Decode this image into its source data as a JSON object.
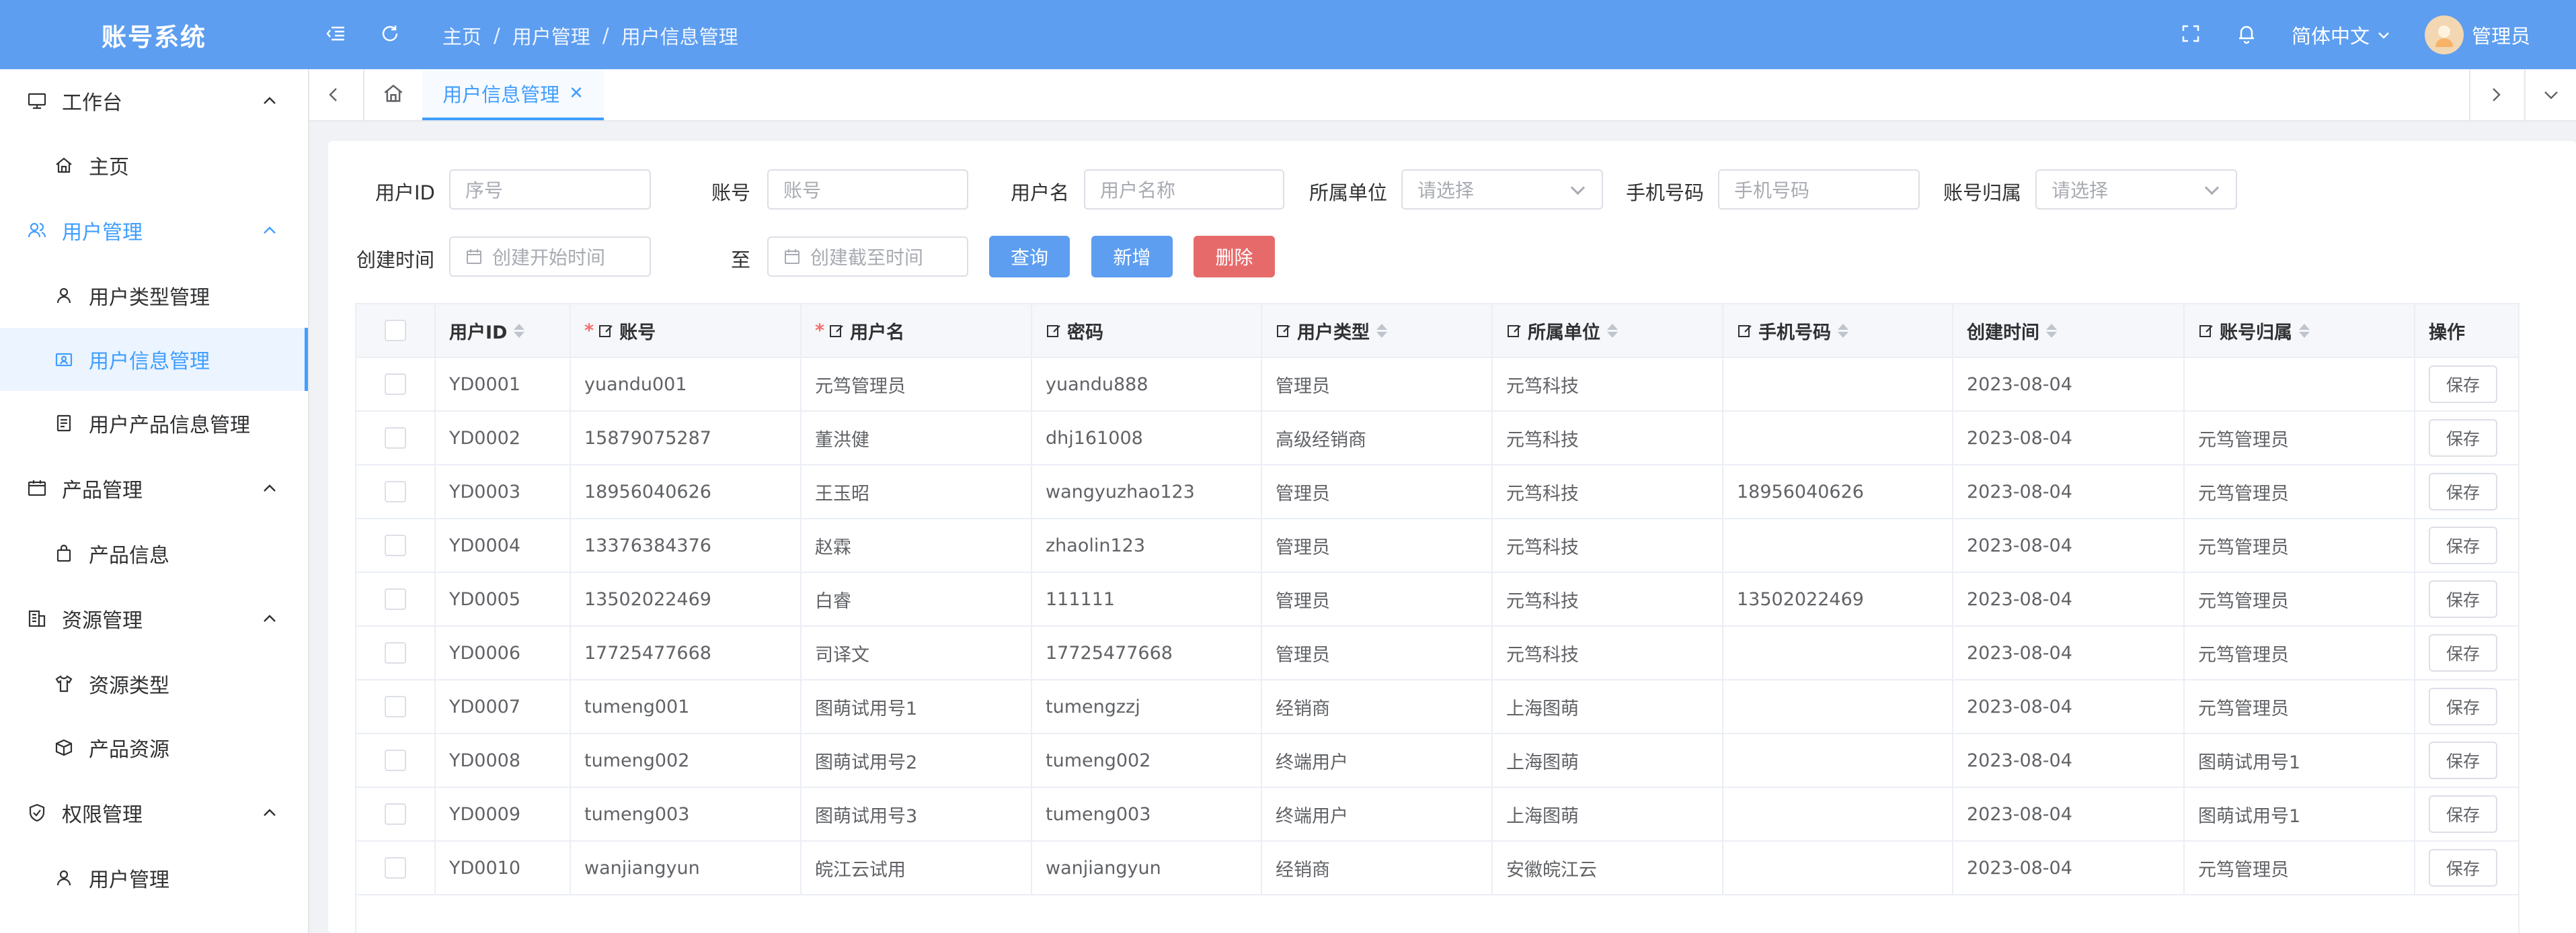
{
  "app": {
    "title": "账号系统"
  },
  "header": {
    "breadcrumb": [
      "主页",
      "用户管理",
      "用户信息管理"
    ],
    "language": "简体中文",
    "user_name": "管理员"
  },
  "sidebar": {
    "groups": [
      {
        "label": "工作台",
        "items": [
          "主页"
        ]
      },
      {
        "label": "用户管理",
        "items": [
          "用户类型管理",
          "用户信息管理",
          "用户产品信息管理"
        ]
      },
      {
        "label": "产品管理",
        "items": [
          "产品信息"
        ]
      },
      {
        "label": "资源管理",
        "items": [
          "资源类型",
          "产品资源"
        ]
      },
      {
        "label": "权限管理",
        "items": [
          "用户管理"
        ]
      }
    ],
    "active_item": "用户信息管理"
  },
  "tabs": {
    "active": "用户信息管理"
  },
  "search": {
    "user_id": {
      "label": "用户ID",
      "placeholder": "序号"
    },
    "account": {
      "label": "账号",
      "placeholder": "账号"
    },
    "username": {
      "label": "用户名",
      "placeholder": "用户名称"
    },
    "unit": {
      "label": "所属单位",
      "placeholder": "请选择"
    },
    "phone": {
      "label": "手机号码",
      "placeholder": "手机号码"
    },
    "owner": {
      "label": "账号归属",
      "placeholder": "请选择"
    },
    "created": {
      "label": "创建时间",
      "start_placeholder": "创建开始时间",
      "to": "至",
      "end_placeholder": "创建截至时间"
    }
  },
  "buttons": {
    "query": "查询",
    "add": "新增",
    "delete": "删除"
  },
  "table": {
    "columns": [
      "用户ID",
      "账号",
      "用户名",
      "密码",
      "用户类型",
      "所属单位",
      "手机号码",
      "创建时间",
      "账号归属",
      "操作"
    ],
    "save_label": "保存",
    "rows": [
      [
        "YD0001",
        "yuandu001",
        "元笃管理员",
        "yuandu888",
        "管理员",
        "元笃科技",
        "",
        "2023-08-04",
        ""
      ],
      [
        "YD0002",
        "15879075287",
        "董洪健",
        "dhj161008",
        "高级经销商",
        "元笃科技",
        "",
        "2023-08-04",
        "元笃管理员"
      ],
      [
        "YD0003",
        "18956040626",
        "王玉昭",
        "wangyuzhao123",
        "管理员",
        "元笃科技",
        "18956040626",
        "2023-08-04",
        "元笃管理员"
      ],
      [
        "YD0004",
        "13376384376",
        "赵霖",
        "zhaolin123",
        "管理员",
        "元笃科技",
        "",
        "2023-08-04",
        "元笃管理员"
      ],
      [
        "YD0005",
        "13502022469",
        "白睿",
        "111111",
        "管理员",
        "元笃科技",
        "13502022469",
        "2023-08-04",
        "元笃管理员"
      ],
      [
        "YD0006",
        "17725477668",
        "司译文",
        "17725477668",
        "管理员",
        "元笃科技",
        "",
        "2023-08-04",
        "元笃管理员"
      ],
      [
        "YD0007",
        "tumeng001",
        "图萌试用号1",
        "tumengzzj",
        "经销商",
        "上海图萌",
        "",
        "2023-08-04",
        "元笃管理员"
      ],
      [
        "YD0008",
        "tumeng002",
        "图萌试用号2",
        "tumeng002",
        "终端用户",
        "上海图萌",
        "",
        "2023-08-04",
        "图萌试用号1"
      ],
      [
        "YD0009",
        "tumeng003",
        "图萌试用号3",
        "tumeng003",
        "终端用户",
        "上海图萌",
        "",
        "2023-08-04",
        "图萌试用号1"
      ],
      [
        "YD0010",
        "wanjiangyun",
        "皖江云试用",
        "wanjiangyun",
        "经销商",
        "安徽皖江云",
        "",
        "2023-08-04",
        "元笃管理员"
      ]
    ]
  }
}
